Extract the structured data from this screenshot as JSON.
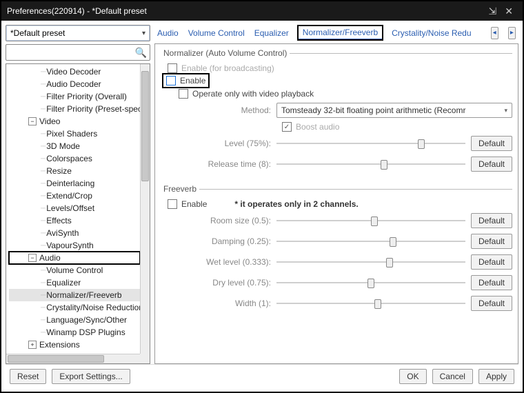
{
  "window": {
    "title": "Preferences(220914) - *Default preset"
  },
  "preset": {
    "selected": "*Default preset"
  },
  "tabs": {
    "items": [
      "Audio",
      "Volume Control",
      "Equalizer",
      "Normalizer/Freeverb",
      "Crystality/Noise Redu"
    ],
    "active_index": 3
  },
  "tree": {
    "top_children": [
      "Video Decoder",
      "Audio Decoder",
      "Filter Priority (Overall)",
      "Filter Priority (Preset-specifi"
    ],
    "video_label": "Video",
    "video_children": [
      "Pixel Shaders",
      "3D Mode",
      "Colorspaces",
      "Resize",
      "Deinterlacing",
      "Extend/Crop",
      "Levels/Offset",
      "Effects",
      "AviSynth",
      "VapourSynth"
    ],
    "audio_label": "Audio",
    "audio_children": [
      "Volume Control",
      "Equalizer",
      "Normalizer/Freeverb",
      "Crystality/Noise Reduction",
      "Language/Sync/Other",
      "Winamp DSP Plugins"
    ],
    "ext_label": "Extensions",
    "selected_leaf": "Normalizer/Freeverb"
  },
  "normalizer": {
    "legend": "Normalizer (Auto Volume Control)",
    "enable_broadcast": "Enable (for broadcasting)",
    "enable": "Enable",
    "only_video": "Operate only with video playback",
    "method_label": "Method:",
    "method_value": "Tomsteady 32-bit floating point arithmetic (Recomr",
    "boost": "Boost audio",
    "level_label": "Level (75%):",
    "release_label": "Release time (8):",
    "default": "Default",
    "level_pct": 75,
    "release_pct": 55
  },
  "freeverb": {
    "legend": "Freeverb",
    "enable": "Enable",
    "note": "* it operates only in 2 channels.",
    "room_label": "Room size (0.5):",
    "damping_label": "Damping (0.25):",
    "wet_label": "Wet level (0.333):",
    "dry_label": "Dry level (0.75):",
    "width_label": "Width (1):",
    "default": "Default",
    "room_pct": 50,
    "damping_pct": 60,
    "wet_pct": 58,
    "dry_pct": 48,
    "width_pct": 52
  },
  "buttons": {
    "reset": "Reset",
    "export": "Export Settings...",
    "ok": "OK",
    "cancel": "Cancel",
    "apply": "Apply"
  }
}
